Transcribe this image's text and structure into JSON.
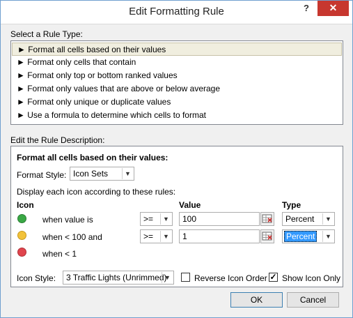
{
  "window": {
    "title": "Edit Formatting Rule",
    "help_label": "?",
    "close_label": "✕"
  },
  "rule_type": {
    "label": "Select a Rule Type:",
    "items": [
      "► Format all cells based on their values",
      "► Format only cells that contain",
      "► Format only top or bottom ranked values",
      "► Format only values that are above or below average",
      "► Format only unique or duplicate values",
      "► Use a formula to determine which cells to format"
    ],
    "selected_index": 0
  },
  "description": {
    "label": "Edit the Rule Description:",
    "heading": "Format all cells based on their values:",
    "format_style_label": "Format Style:",
    "format_style_value": "Icon Sets",
    "display_text": "Display each icon according to these rules:",
    "col_icon": "Icon",
    "col_value": "Value",
    "col_type": "Type",
    "rows": [
      {
        "icon_color": "#3aa845",
        "condition": "when value is",
        "operator": ">=",
        "value": "100",
        "type": "Percent"
      },
      {
        "icon_color": "#f2c23a",
        "condition": "when < 100 and",
        "operator": ">=",
        "value": "1",
        "type": "Percent"
      },
      {
        "icon_color": "#e0454d",
        "condition": "when < 1",
        "operator": "",
        "value": "",
        "type": ""
      }
    ],
    "icon_style_label": "Icon Style:",
    "icon_style_value": "3 Traffic Lights (Unrimmed)",
    "reverse_label": "Reverse Icon Order",
    "reverse_checked": false,
    "show_icon_label": "Show Icon Only",
    "show_icon_checked": true
  },
  "buttons": {
    "ok": "OK",
    "cancel": "Cancel"
  },
  "colors": {
    "close_red": "#c7372f",
    "selection_blue": "#3399ff",
    "list_selected": "#f0eedf"
  }
}
